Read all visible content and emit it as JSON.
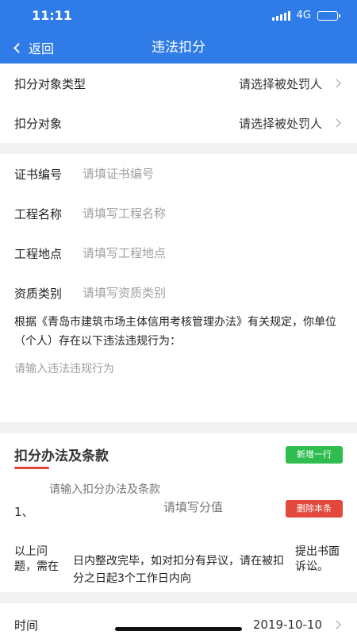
{
  "status": {
    "time": "11:11",
    "network": "4G"
  },
  "nav": {
    "back_label": "返回",
    "title": "违法扣分"
  },
  "target_type": {
    "label": "扣分对象类型",
    "value": "请选择被处罚人"
  },
  "target": {
    "label": "扣分对象",
    "value": "请选择被处罚人"
  },
  "fields": [
    {
      "label": "证书编号",
      "placeholder": "请填证书编号"
    },
    {
      "label": "工程名称",
      "placeholder": "请填写工程名称"
    },
    {
      "label": "工程地点",
      "placeholder": "请填写工程地点"
    },
    {
      "label": "资质类别",
      "placeholder": "请填写资质类别"
    }
  ],
  "regulation_text": "根据《青岛市建筑市场主体信用考核管理办法》有关规定，你单位（个人）存在以下违法违规行为：",
  "violation_placeholder": "请输入违法违规行为",
  "clauses": {
    "title": "扣分办法及条款",
    "add_row": "新增一行",
    "item_index": "1、",
    "item_method_placeholder": "请输入扣分办法及条款",
    "item_score_placeholder": "请填写分值",
    "delete_item": "删除本条"
  },
  "notice": {
    "left": "以上问题，需在",
    "middle": "日内整改完毕，如对扣分有异议，请在被扣分之日起3个工作日内向",
    "right": "提出书面诉讼。"
  },
  "date_row": {
    "label": "时间",
    "value": "2019-10-10"
  }
}
